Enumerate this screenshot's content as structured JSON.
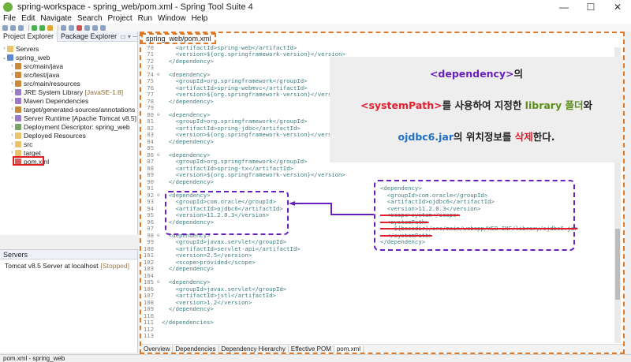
{
  "window": {
    "title": "spring-workspace - spring_web/pom.xml - Spring Tool Suite 4",
    "controls": [
      "—",
      "☐",
      "✕"
    ]
  },
  "menu": [
    "File",
    "Edit",
    "Navigate",
    "Search",
    "Project",
    "Run",
    "Window",
    "Help"
  ],
  "project_explorer": {
    "tabs": [
      "Project Explorer",
      "Package Explorer"
    ],
    "items": [
      {
        "label": "Servers",
        "icon": "folder-icon"
      },
      {
        "label": "spring_web",
        "icon": "project-icon"
      },
      {
        "label": "src/main/java",
        "icon": "package-icon"
      },
      {
        "label": "src/test/java",
        "icon": "package-icon"
      },
      {
        "label": "src/main/resources",
        "icon": "package-icon"
      },
      {
        "label": "JRE System Library",
        "extra": "[JavaSE-1.8]",
        "icon": "library-icon"
      },
      {
        "label": "Maven Dependencies",
        "icon": "library-icon"
      },
      {
        "label": "target/generated-sources/annotations",
        "icon": "package-icon"
      },
      {
        "label": "Server Runtime [Apache Tomcat v8.5]",
        "icon": "library-icon"
      },
      {
        "label": "Deployment Descriptor: spring_web",
        "icon": "descriptor-icon"
      },
      {
        "label": "Deployed Resources",
        "icon": "folder-icon"
      },
      {
        "label": "src",
        "icon": "folder-icon"
      },
      {
        "label": "target",
        "icon": "folder-icon"
      },
      {
        "label": "pom.xml",
        "icon": "xml-icon"
      }
    ]
  },
  "servers": {
    "tab": "Servers",
    "row_label": "Tomcat v8.5 Server at localhost",
    "row_state": "[Stopped]"
  },
  "editor": {
    "tab": "spring_web/pom.xml",
    "bottom_tabs": [
      "Overview",
      "Dependencies",
      "Dependency Hierarchy",
      "Effective POM",
      "pom.xml"
    ],
    "lines": [
      {
        "n": "70",
        "t": "    <artifactId>spring-web</artifactId>"
      },
      {
        "n": "71",
        "t": "    <version>${org.springframework-version}</version>"
      },
      {
        "n": "72",
        "t": "  </dependency>"
      },
      {
        "n": "73",
        "t": ""
      },
      {
        "n": "74",
        "t": "  <dependency>",
        "fold": true
      },
      {
        "n": "75",
        "t": "    <groupId>org.springframework</groupId>"
      },
      {
        "n": "76",
        "t": "    <artifactId>spring-webmvc</artifactId>"
      },
      {
        "n": "77",
        "t": "    <version>${org.springframework-version}</version>"
      },
      {
        "n": "78",
        "t": "  </dependency>"
      },
      {
        "n": "79",
        "t": ""
      },
      {
        "n": "80",
        "t": "  <dependency>",
        "fold": true
      },
      {
        "n": "81",
        "t": "    <groupId>org.springframework</groupId>"
      },
      {
        "n": "82",
        "t": "    <artifactId>spring-jdbc</artifactId>"
      },
      {
        "n": "83",
        "t": "    <version>${org.springframework-version}</version>"
      },
      {
        "n": "84",
        "t": "  </dependency>"
      },
      {
        "n": "85",
        "t": ""
      },
      {
        "n": "86",
        "t": "  <dependency>",
        "fold": true
      },
      {
        "n": "87",
        "t": "    <groupId>org.springframework</groupId>"
      },
      {
        "n": "88",
        "t": "    <artifactId>spring-tx</artifactId>"
      },
      {
        "n": "89",
        "t": "    <version>${org.springframework-version}</version>"
      },
      {
        "n": "90",
        "t": "  </dependency>"
      },
      {
        "n": "91",
        "t": ""
      },
      {
        "n": "92",
        "t": "  <dependency>",
        "fold": true
      },
      {
        "n": "93",
        "t": "    <groupId>com.oracle</groupId>"
      },
      {
        "n": "94",
        "t": "    <artifactId>ojdbc6</artifactId>"
      },
      {
        "n": "95",
        "t": "    <version>11.2.0.3</version>"
      },
      {
        "n": "96",
        "t": "  </dependency>"
      },
      {
        "n": "97",
        "t": ""
      },
      {
        "n": "98",
        "t": "  <dependency>",
        "fold": true
      },
      {
        "n": "99",
        "t": "    <groupId>javax.servlet</groupId>"
      },
      {
        "n": "100",
        "t": "    <artifactId>servlet-api</artifactId>"
      },
      {
        "n": "101",
        "t": "    <version>2.5</version>"
      },
      {
        "n": "102",
        "t": "    <scope>provided</scope>"
      },
      {
        "n": "103",
        "t": "  </dependency>"
      },
      {
        "n": "104",
        "t": ""
      },
      {
        "n": "105",
        "t": "  <dependency>",
        "fold": true
      },
      {
        "n": "106",
        "t": "    <groupId>javax.servlet</groupId>"
      },
      {
        "n": "107",
        "t": "    <artifactId>jstl</artifactId>"
      },
      {
        "n": "108",
        "t": "    <version>1.2</version>"
      },
      {
        "n": "109",
        "t": "  </dependency>"
      },
      {
        "n": "110",
        "t": ""
      },
      {
        "n": "111",
        "t": "</dependencies>"
      },
      {
        "n": "112",
        "t": ""
      },
      {
        "n": "113",
        "t": ""
      }
    ]
  },
  "callout": {
    "line1_a": "<dependency>",
    "line1_b": "의",
    "line2_a": "<systemPath>",
    "line2_b": "를 사용하여 지정한 ",
    "line2_c": "library",
    "line2_d": " 폴더",
    "line2_e": "와",
    "line3_a": "ojdbc6.jar",
    "line3_b": "의 위치정보를 ",
    "line3_c": "삭제",
    "line3_d": "한다."
  },
  "before_box": {
    "lines": [
      "<dependency>",
      "  <groupId>com.oracle</groupId>",
      "  <artifactId>ojdbc6</artifactId>",
      "  <version>11.2.0.3</version>"
    ],
    "struck": [
      "  <scope>system</scope>",
      "  <systemPath>",
      "    ${basedir}/src/main/webapp/WEB-INF/library/ojdbc6.jar",
      "  </systemPath>"
    ],
    "closing": "</dependency>"
  },
  "status": "pom.xml - spring_web",
  "colors": {
    "annotation_orange": "#e07a28",
    "annotation_purple": "#6a1fbf",
    "highlight_red": "#e0202f",
    "xml_tag": "#3f7f7f"
  }
}
